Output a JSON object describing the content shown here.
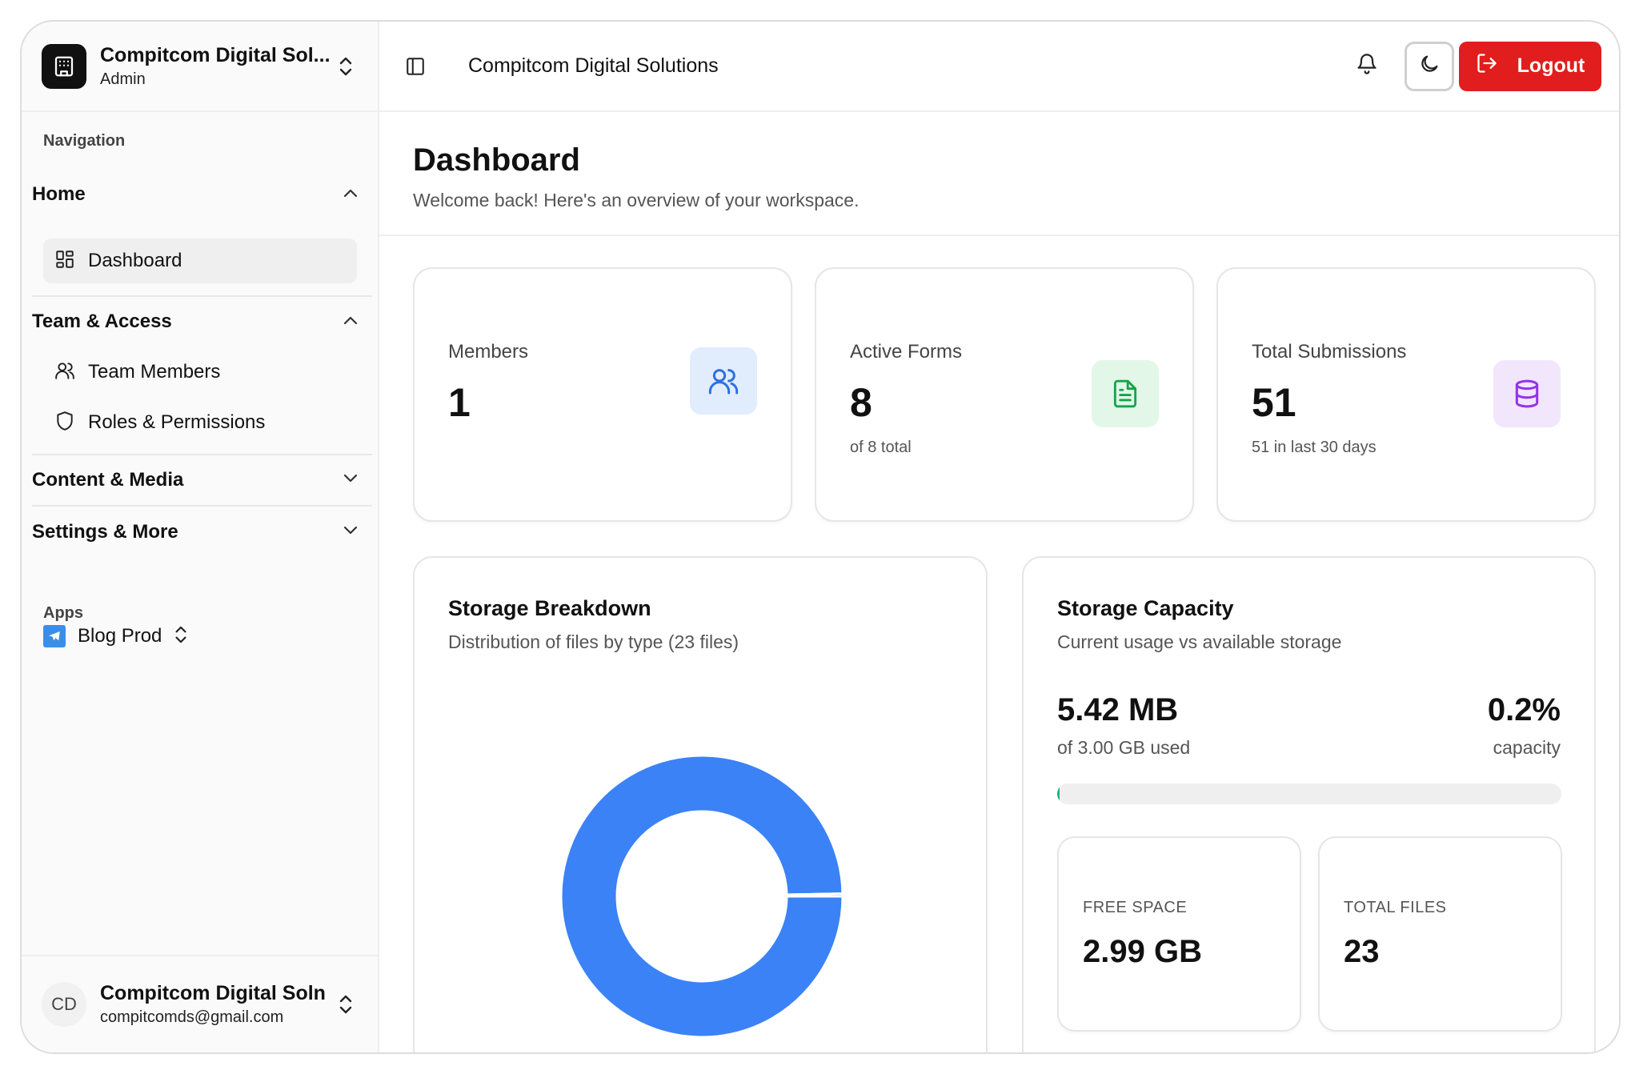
{
  "workspace": {
    "name": "Compitcom Digital Sol...",
    "role": "Admin"
  },
  "sidebar": {
    "nav_label": "Navigation",
    "groups": [
      {
        "title": "Home",
        "expanded": true,
        "items": [
          {
            "label": "Dashboard",
            "icon": "grid-icon",
            "active": true
          }
        ]
      },
      {
        "title": "Team & Access",
        "expanded": true,
        "items": [
          {
            "label": "Team Members",
            "icon": "users-icon"
          },
          {
            "label": "Roles & Permissions",
            "icon": "shield-icon"
          }
        ]
      },
      {
        "title": "Content & Media",
        "expanded": false,
        "items": []
      },
      {
        "title": "Settings & More",
        "expanded": false,
        "items": []
      }
    ],
    "apps_label": "Apps",
    "app": {
      "label": "Blog Prod",
      "icon": "telegram-icon"
    }
  },
  "user": {
    "initials": "CD",
    "name": "Compitcom Digital Soln",
    "email": "compitcomds@gmail.com"
  },
  "topbar": {
    "title": "Compitcom Digital Solutions",
    "logout_label": "Logout"
  },
  "page": {
    "title": "Dashboard",
    "subtitle": "Welcome back! Here's an overview of your workspace."
  },
  "stats": [
    {
      "label": "Members",
      "value": "1",
      "sub": "",
      "icon": "users-icon",
      "color": "#2f6fe0",
      "bg": "#e1edfd"
    },
    {
      "label": "Active Forms",
      "value": "8",
      "sub": "of 8 total",
      "icon": "document-icon",
      "color": "#16a34a",
      "bg": "#e2f7e8"
    },
    {
      "label": "Total Submissions",
      "value": "51",
      "sub": "51 in last 30 days",
      "icon": "database-icon",
      "color": "#9333ea",
      "bg": "#f2e6fd"
    }
  ],
  "storage_breakdown": {
    "title": "Storage Breakdown",
    "desc": "Distribution of files by type (23 files)"
  },
  "chart_data": {
    "type": "pie",
    "donut": true,
    "categories": [
      "",
      ""
    ],
    "values": [
      99.7,
      0.3
    ],
    "colors": [
      "#3b82f6",
      "#3b82f6"
    ]
  },
  "storage_capacity": {
    "title": "Storage Capacity",
    "desc": "Current usage vs available storage",
    "used": "5.42 MB",
    "used_sub": "of 3.00 GB used",
    "percent": "0.2%",
    "percent_sub": "capacity",
    "progress_fraction": 0.002,
    "progress_color": "#22b07d",
    "free_label": "FREE SPACE",
    "free_value": "2.99 GB",
    "files_label": "TOTAL FILES",
    "files_value": "23"
  }
}
